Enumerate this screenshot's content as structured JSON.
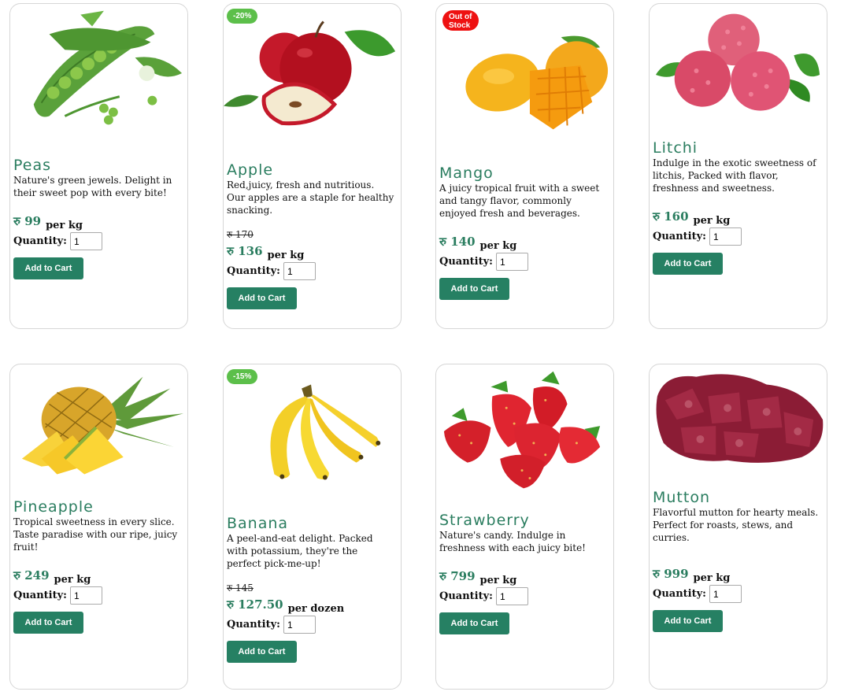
{
  "colors": {
    "accent": "#2a7d5f",
    "button": "#268063",
    "discount_badge": "#5cbf4a",
    "stock_badge": "#ee1111"
  },
  "common": {
    "quantity_label": "Quantity:",
    "add_to_cart_label": "Add to Cart",
    "default_quantity": "1"
  },
  "products": [
    {
      "name": "Peas",
      "image": "peas-image",
      "description": "Nature's green jewels. Delight in their sweet pop with every bite!",
      "price": "रु 99",
      "unit": "per kg"
    },
    {
      "name": "Apple",
      "image": "apple-image",
      "badge": "-20%",
      "description": "Red,juicy, fresh and nutritious. Our apples are a staple for healthy snacking.",
      "old_price": "रु 170",
      "price": "रु 136",
      "unit": "per kg"
    },
    {
      "name": "Mango",
      "image": "mango-image",
      "badge": "Out of Stock",
      "description": "A juicy tropical fruit with a sweet and tangy flavor, commonly enjoyed fresh and beverages.",
      "price": "रु 140",
      "unit": "per kg"
    },
    {
      "name": "Litchi",
      "image": "litchi-image",
      "description": "Indulge in the exotic sweetness of litchis, Packed with flavor, freshness and sweetness.",
      "price": "रु 160",
      "unit": "per kg"
    },
    {
      "name": "Pineapple",
      "image": "pineapple-image",
      "description": "Tropical sweetness in every slice. Taste paradise with our ripe, juicy fruit!",
      "price": "रु 249",
      "unit": "per kg"
    },
    {
      "name": "Banana",
      "image": "banana-image",
      "badge": "-15%",
      "description": "A peel-and-eat delight. Packed with potassium, they're the perfect pick-me-up!",
      "old_price": "रु 145",
      "price": "रु 127.50",
      "unit": "per dozen"
    },
    {
      "name": "Strawberry",
      "image": "strawberry-image",
      "description": "Nature's candy. Indulge in freshness with each juicy bite!",
      "price": "रु 799",
      "unit": "per kg"
    },
    {
      "name": "Mutton",
      "image": "mutton-image",
      "description": "Flavorful mutton for hearty meals. Perfect for roasts, stews, and curries.",
      "price": "रु 999",
      "unit": "per kg"
    }
  ]
}
